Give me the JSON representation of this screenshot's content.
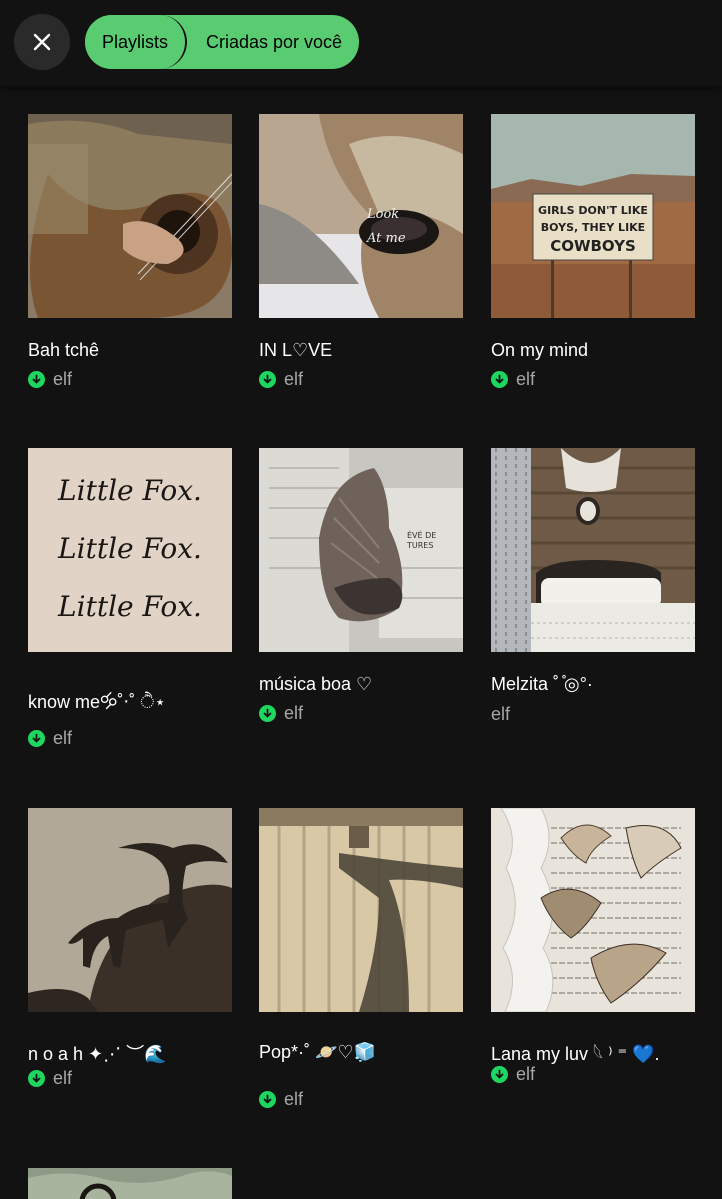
{
  "header": {
    "close_icon": "close-icon",
    "chips": {
      "playlists": "Playlists",
      "created": "Criadas por você"
    },
    "accent_color": "#59cc72"
  },
  "playlists": [
    {
      "title": "Bah tchê",
      "owner": "elf",
      "downloaded": true,
      "cover": "guitar-player"
    },
    {
      "title": "IN  L♡VE",
      "owner": "elf",
      "downloaded": true,
      "cover": "deer-eye",
      "cover_text": [
        "Look",
        "At me"
      ]
    },
    {
      "title": "On my mind",
      "owner": "elf",
      "downloaded": true,
      "cover": "desert-sign",
      "cover_text": [
        "GIRLS DON'T LIKE",
        "BOYS, THEY LIKE",
        "COWBOYS"
      ]
    },
    {
      "title": "know me🝰˚‧˚ ੈ⋆",
      "owner": "elf",
      "downloaded": true,
      "cover": "little-fox-page",
      "cover_text": [
        "Little Fox.",
        "Little Fox.",
        "Little Fox."
      ]
    },
    {
      "title": "música boa ♡",
      "owner": "elf",
      "downloaded": true,
      "cover": "bird-wing",
      "cover_text": [
        "ÉVÉ DE",
        "TURES"
      ]
    },
    {
      "title": "Melzita ˚⁠ ̊⁠◎⁠°·",
      "owner": "elf",
      "downloaded": false,
      "cover": "rustic-bedroom"
    },
    {
      "title": "n o a h ✦⋰ ︶🌊",
      "owner": "elf",
      "downloaded": true,
      "cover": "coyote-rock"
    },
    {
      "title": "Pop*·˚ 🪐♡🧊",
      "owner": "elf",
      "downloaded": true,
      "cover": "fence-shadow"
    },
    {
      "title": "Lana my luv 𓆩 ⁾ ⁼ 💙.",
      "owner": "elf",
      "downloaded": true,
      "cover": "butterflies-book"
    }
  ]
}
